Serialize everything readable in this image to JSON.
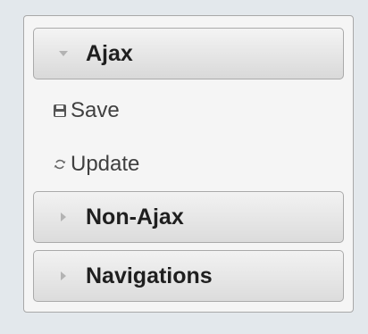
{
  "menu": {
    "sections": [
      {
        "label": "Ajax",
        "state": "expanded",
        "arrow_icon": "triangle-down-icon"
      },
      {
        "label": "Non-Ajax",
        "state": "collapsed",
        "arrow_icon": "triangle-right-icon"
      },
      {
        "label": "Navigations",
        "state": "collapsed",
        "arrow_icon": "triangle-right-icon"
      }
    ],
    "ajax_items": [
      {
        "label": "Save",
        "icon": "disk-icon"
      },
      {
        "label": "Update",
        "icon": "refresh-icon"
      }
    ]
  },
  "colors": {
    "background": "#e3e8ec",
    "panel": "#f5f5f5",
    "header_border": "#aaaaaa",
    "text": "#1f1f1f",
    "item_text": "#404040"
  }
}
